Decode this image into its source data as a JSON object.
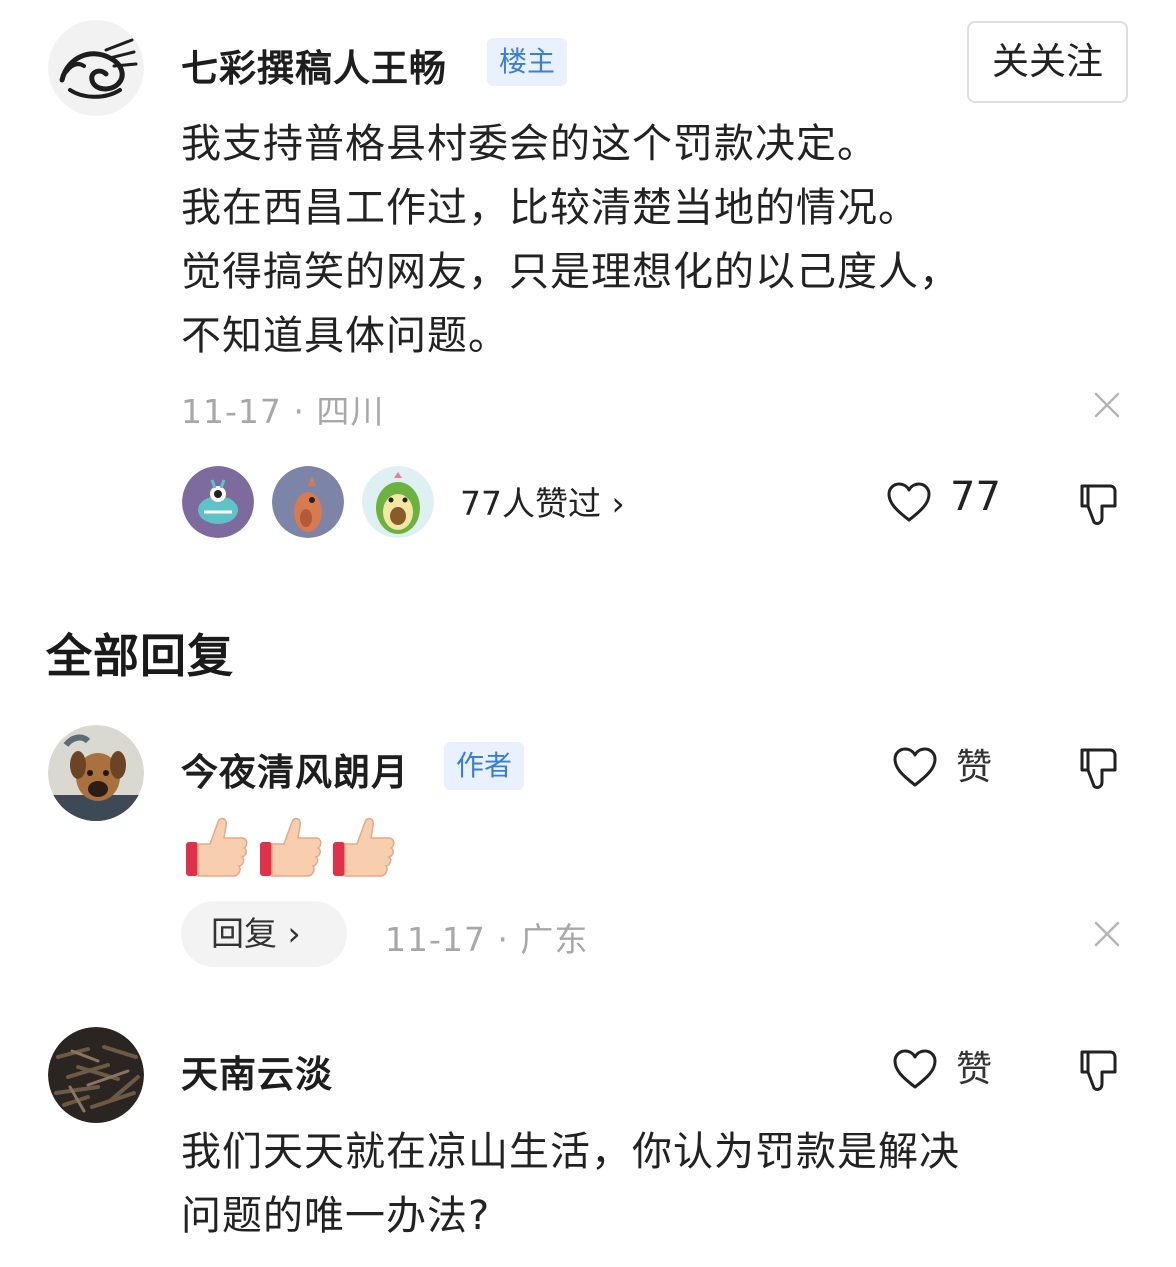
{
  "post": {
    "username": "七彩撰稿人王畅",
    "badge": "楼主",
    "follow_label": "关关注",
    "lines": [
      "我支持普格县村委会的这个罚款决定。",
      "我在西昌工作过，比较清楚当地的情况。",
      "觉得搞笑的网友，只是理想化的以己度人，",
      "不知道具体问题。"
    ],
    "meta": "11-17 · 四川",
    "likers_text": "77人赞过 ›",
    "like_count": "77"
  },
  "replies_section": {
    "title": "全部回复"
  },
  "replies": [
    {
      "username": "今夜清风朗月",
      "badge": "作者",
      "like_label": "赞",
      "reply_label": "回复 ›",
      "meta": "11-17 · 广东",
      "emoji_count": 3
    },
    {
      "username": "天南云淡",
      "like_label": "赞",
      "lines": [
        "我们天天就在凉山生活，你认为罚款是解决",
        "问题的唯一办法?"
      ]
    }
  ],
  "icons": [
    "user-avatar",
    "close-icon",
    "heart-icon",
    "dislike-icon",
    "thumbs-up-emoji"
  ],
  "colors": {
    "badge_bg": "#e8f1fd",
    "badge_text": "#3a7fd6",
    "meta_text": "#a8a8a8"
  }
}
